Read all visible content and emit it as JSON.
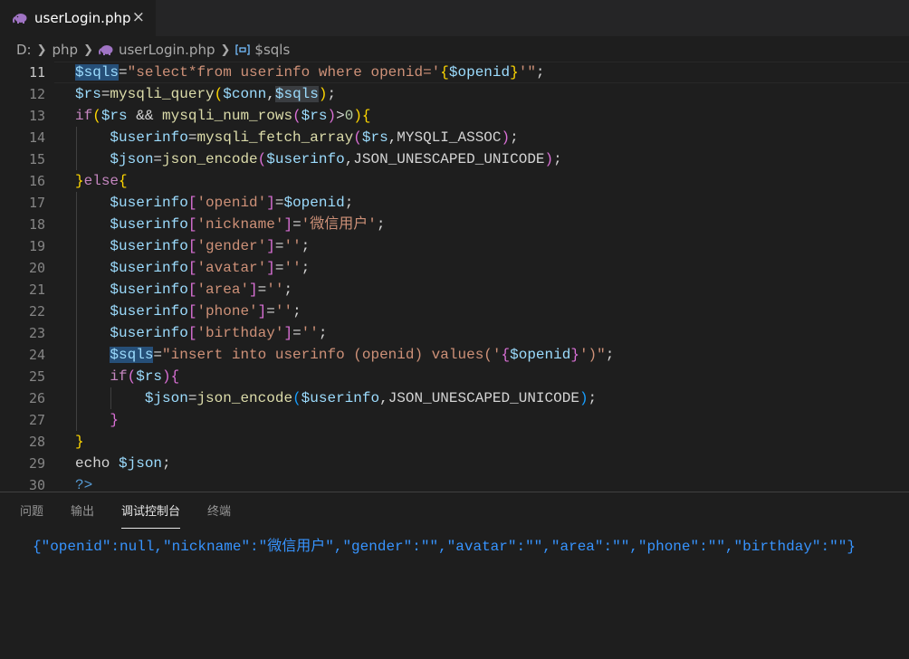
{
  "tab": {
    "label": "userLogin.php",
    "close": "×"
  },
  "breadcrumb": {
    "drive": "D:",
    "folder": "php",
    "file": "userLogin.php",
    "symbol": "$sqls"
  },
  "lines": [
    "11",
    "12",
    "13",
    "14",
    "15",
    "16",
    "17",
    "18",
    "19",
    "20",
    "21",
    "22",
    "23",
    "24",
    "25",
    "26",
    "27",
    "28",
    "29",
    "30"
  ],
  "code": {
    "l11": [
      "$sql",
      "s",
      "=",
      "\"select*from userinfo where openid='",
      "{",
      "$openid",
      "}",
      "'\"",
      ";"
    ],
    "l12": [
      "$rs",
      "=",
      "mysqli_query",
      "(",
      "$conn",
      ",",
      "$sqls",
      ")",
      ";"
    ],
    "l13": [
      "if",
      "(",
      "$rs",
      " && ",
      "mysqli_num_rows",
      "(",
      "$rs",
      ")",
      ">",
      "0",
      ")",
      "{"
    ],
    "l14": [
      "$userinfo",
      "=",
      "mysqli_fetch_array",
      "(",
      "$rs",
      ",MYSQLI_ASSOC",
      ")",
      ";"
    ],
    "l15": [
      "$json",
      "=",
      "json_encode",
      "(",
      "$userinfo",
      ",JSON_UNESCAPED_UNICODE",
      ")",
      ";"
    ],
    "l16": [
      "}",
      "else",
      "{"
    ],
    "l17": [
      "$userinfo",
      "[",
      "'openid'",
      "]",
      "=",
      "$openid",
      ";"
    ],
    "l18": [
      "$userinfo",
      "[",
      "'nickname'",
      "]",
      "=",
      "'微信用户'",
      ";"
    ],
    "l19": [
      "$userinfo",
      "[",
      "'gender'",
      "]",
      "=",
      "''",
      ";"
    ],
    "l20": [
      "$userinfo",
      "[",
      "'avatar'",
      "]",
      "=",
      "''",
      ";"
    ],
    "l21": [
      "$userinfo",
      "[",
      "'area'",
      "]",
      "=",
      "''",
      ";"
    ],
    "l22": [
      "$userinfo",
      "[",
      "'phone'",
      "]",
      "=",
      "''",
      ";"
    ],
    "l23": [
      "$userinfo",
      "[",
      "'birthday'",
      "]",
      "=",
      "''",
      ";"
    ],
    "l24": [
      "$sqls",
      "=",
      "\"insert into userinfo (openid) values('",
      "{",
      "$openid",
      "}",
      "')\"",
      ";"
    ],
    "l25": [
      "if",
      "(",
      "$rs",
      ")",
      "{"
    ],
    "l26": [
      "$json",
      "=",
      "json_encode",
      "(",
      "$userinfo",
      ",JSON_UNESCAPED_UNICODE",
      ")",
      ";"
    ],
    "l27": [
      "}"
    ],
    "l28": [
      "}"
    ],
    "l29": [
      "echo",
      " ",
      "$json",
      ";"
    ],
    "l30": [
      "?>"
    ]
  },
  "panel": {
    "tabs": [
      "问题",
      "输出",
      "调试控制台",
      "终端"
    ],
    "active_tab": "调试控制台",
    "output": "{\"openid\":null,\"nickname\":\"微信用户\",\"gender\":\"\",\"avatar\":\"\",\"area\":\"\",\"phone\":\"\",\"birthday\":\"\"}"
  },
  "colors": {
    "background": "#1e1e1e",
    "variable": "#9cdcfe",
    "keyword": "#c586c0",
    "function": "#dcdcaa",
    "string": "#ce9178",
    "console_output": "#3794ff"
  },
  "icons": {
    "file": "php-elephant-icon",
    "close": "close-icon",
    "separator": "chevron-right-icon",
    "symbol": "variable-symbol-icon"
  }
}
